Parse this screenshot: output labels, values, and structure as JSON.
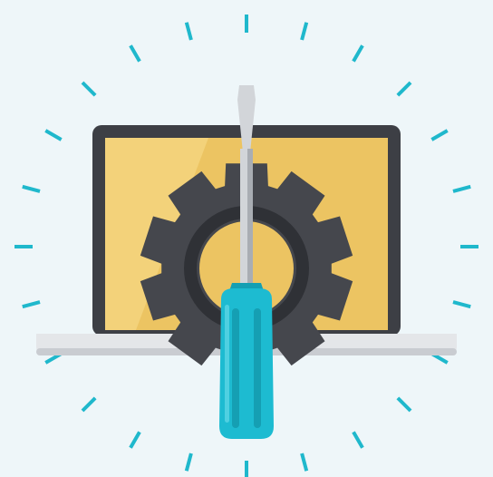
{
  "colors": {
    "background": "#eef6f9",
    "accent_ticks": "#1fb8cc",
    "laptop_bezel": "#3d3f45",
    "laptop_screen": "#ecc462",
    "laptop_screen_glare": "#f3d27a",
    "laptop_base": "#e4e6e9",
    "laptop_base_shadow": "#c9ccd1",
    "gear": "#45474d",
    "gear_inner_shadow": "#2f3136",
    "screwdriver_shaft": "#d2d5d9",
    "screwdriver_shaft_shadow": "#a9adb3",
    "screwdriver_handle": "#1dbbd1",
    "screwdriver_handle_dark": "#159fb3",
    "screwdriver_handle_light": "#4fd0e1"
  },
  "icons": {
    "main": "settings-repair-illustration",
    "elements": [
      "laptop-icon",
      "gear-icon",
      "screwdriver-icon",
      "radiating-ticks"
    ]
  }
}
